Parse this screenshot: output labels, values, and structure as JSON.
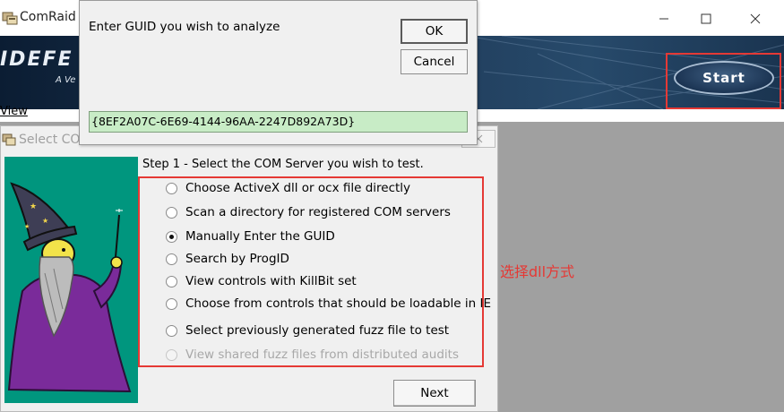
{
  "main_window": {
    "title": "ComRaid",
    "banner_logo": "IDEFE",
    "banner_tagline": "A Ve",
    "start_label": "Start",
    "menu_view": "View"
  },
  "select_window": {
    "title": "Select COM Server",
    "step_label": "Step 1 - Select the COM Server you wish to test.",
    "options": [
      {
        "label": "Choose ActiveX dll or ocx file directly",
        "checked": false,
        "enabled": true
      },
      {
        "label": "Scan a directory for registered COM servers",
        "checked": false,
        "enabled": true
      },
      {
        "label": "Manually Enter the GUID",
        "checked": true,
        "enabled": true
      },
      {
        "label": "Search by ProgID",
        "checked": false,
        "enabled": true
      },
      {
        "label": "View controls with KillBit set",
        "checked": false,
        "enabled": true
      },
      {
        "label": "Choose from controls that should be loadable in IE",
        "checked": false,
        "enabled": true
      },
      {
        "label": "Select previously generated fuzz file to test",
        "checked": false,
        "enabled": true
      },
      {
        "label": "View shared fuzz files from distributed audits",
        "checked": false,
        "enabled": false
      }
    ],
    "next_label": "Next"
  },
  "guid_dialog": {
    "prompt": "Enter GUID you wish to analyze",
    "ok_label": "OK",
    "cancel_label": "Cancel",
    "guid_value": "{8EF2A07C-6E69-4144-96AA-2247D892A73D}"
  },
  "annotation": "选择dll方式",
  "colors": {
    "highlight": "#e53935",
    "wizard_bg": "#00967e",
    "guid_field_bg": "#c8ecc6"
  }
}
